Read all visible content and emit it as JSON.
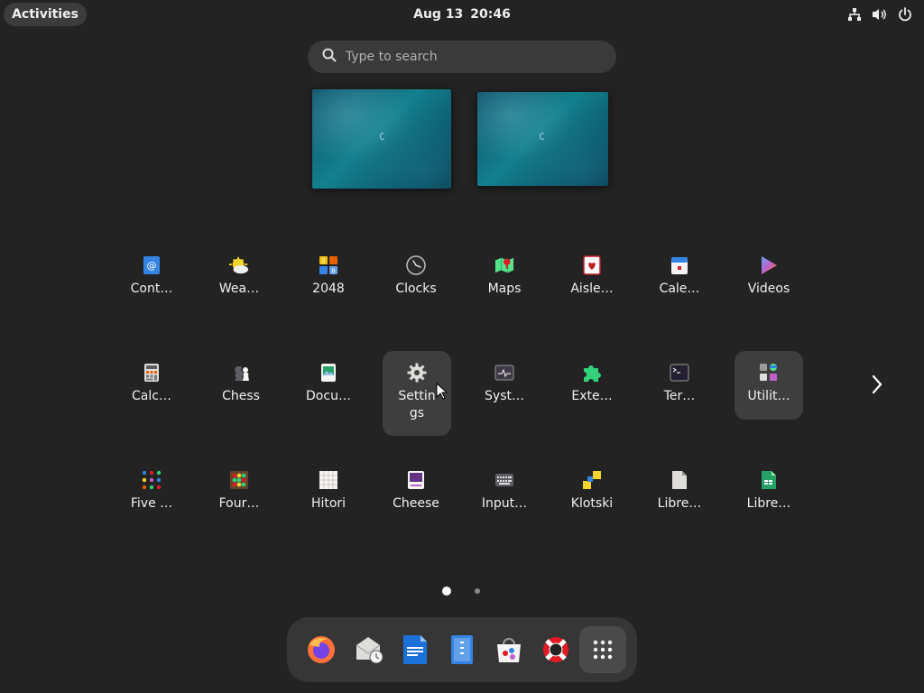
{
  "topbar": {
    "activities_label": "Activities",
    "date": "Aug 13",
    "time": "20:46",
    "tray_icons": [
      "network-icon",
      "volume-icon",
      "power-icon"
    ]
  },
  "search": {
    "placeholder": "Type to search",
    "value": ""
  },
  "workspaces": [
    "workspace-1",
    "workspace-2"
  ],
  "apps": [
    {
      "label": "Cont…",
      "icon": "contacts-icon"
    },
    {
      "label": "Wea…",
      "icon": "weather-icon"
    },
    {
      "label": "2048",
      "icon": "2048-icon"
    },
    {
      "label": "Clocks",
      "icon": "clocks-icon"
    },
    {
      "label": "Maps",
      "icon": "maps-icon"
    },
    {
      "label": "Aisle…",
      "icon": "aisleriot-icon"
    },
    {
      "label": "Cale…",
      "icon": "calendar-icon"
    },
    {
      "label": "Videos",
      "icon": "videos-icon"
    },
    {
      "label": "Calc…",
      "icon": "calculator-icon"
    },
    {
      "label": "Chess",
      "icon": "chess-icon"
    },
    {
      "label": "Docu…",
      "icon": "document-viewer-icon"
    },
    {
      "label": "Settin\ngs",
      "icon": "settings-icon"
    },
    {
      "label": "Syst…",
      "icon": "system-monitor-icon"
    },
    {
      "label": "Exte…",
      "icon": "extensions-icon"
    },
    {
      "label": "Ter…",
      "icon": "terminal-icon"
    },
    {
      "label": "Utilit…",
      "icon": "utilities-folder-icon"
    },
    {
      "label": "Five …",
      "icon": "five-or-more-icon"
    },
    {
      "label": "Four…",
      "icon": "four-in-a-row-icon"
    },
    {
      "label": "Hitori",
      "icon": "hitori-icon"
    },
    {
      "label": "Cheese",
      "icon": "cheese-icon"
    },
    {
      "label": "Input…",
      "icon": "input-method-icon"
    },
    {
      "label": "Klotski",
      "icon": "klotski-icon"
    },
    {
      "label": "Libre…",
      "icon": "libreoffice-icon"
    },
    {
      "label": "Libre…",
      "icon": "libreoffice-calc-icon"
    }
  ],
  "pagination": {
    "pages": 2,
    "current": 1
  },
  "dash": [
    {
      "name": "firefox",
      "icon": "firefox-icon"
    },
    {
      "name": "evolution",
      "icon": "mail-clock-icon"
    },
    {
      "name": "libreoffice-writer",
      "icon": "writer-icon"
    },
    {
      "name": "text-editor",
      "icon": "text-editor-icon"
    },
    {
      "name": "software",
      "icon": "software-store-icon"
    },
    {
      "name": "help",
      "icon": "help-lifebuoy-icon"
    },
    {
      "name": "show-apps",
      "icon": "app-grid-icon"
    }
  ],
  "colors": {
    "background": "#232323",
    "highlight": "#3e3e3e",
    "accent_blue": "#3584e4"
  }
}
